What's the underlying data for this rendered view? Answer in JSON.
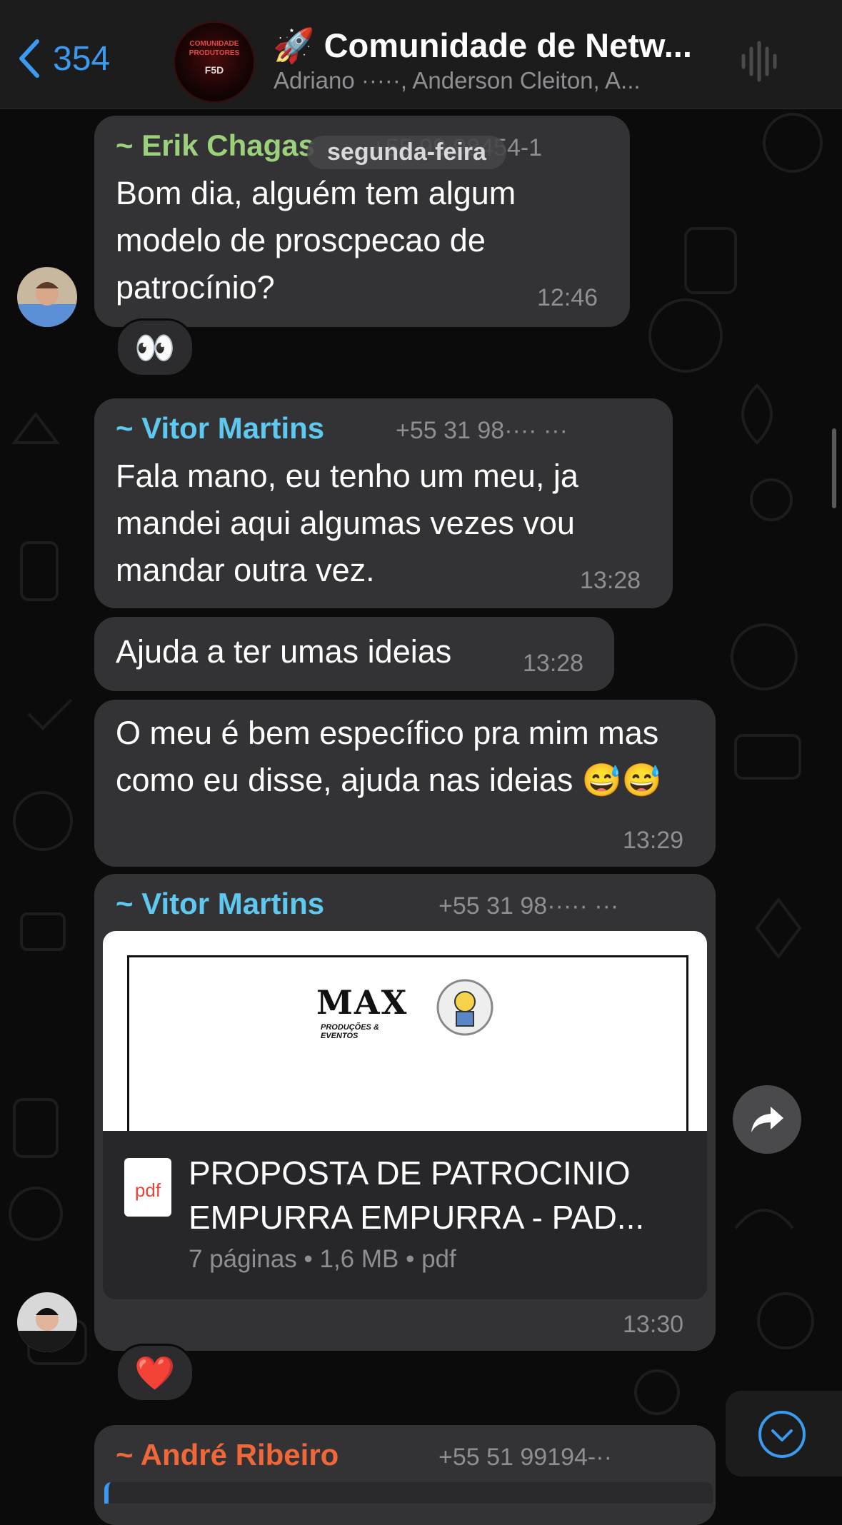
{
  "header": {
    "back_count": "354",
    "title": "🚀 Comunidade de Netw...",
    "subtitle": "Adriano ·····, Anderson Cleiton, A...",
    "avatar_text": [
      "COMUNIDADE",
      "PRODUTORES",
      "F5D"
    ]
  },
  "date_divider": "segunda-feira",
  "messages": [
    {
      "sender": "~ Erik Chagas",
      "phone": "+55 99 98454-1",
      "text": "Bom dia, alguém tem algum modelo de proscpecao de patrocínio?",
      "time": "12:46",
      "reaction": "👀"
    },
    {
      "sender": "~ Vitor Martins",
      "phone": "+55 31 98···· ···",
      "text": "Fala mano, eu tenho um meu, ja mandei aqui algumas vezes vou mandar outra vez.",
      "time": "13:28"
    },
    {
      "text": "Ajuda a ter umas ideias",
      "time": "13:28"
    },
    {
      "text": "O meu é bem específico pra mim mas como eu disse, ajuda nas ideias 😅😅",
      "time": "13:29"
    },
    {
      "sender": "~ Vitor Martins",
      "phone": "+55 31 98····· ···",
      "document": {
        "preview_logo": "MAX",
        "preview_sub": "PRODUÇÕES & EVENTOS",
        "icon_label": "pdf",
        "title": "PROPOSTA DE PATROCINIO EMPURRA EMPURRA - PAD...",
        "meta": "7 páginas • 1,6 MB • pdf"
      },
      "time": "13:30",
      "reaction": "❤️"
    },
    {
      "sender": "~ André Ribeiro",
      "phone": "+55 51 99194-··"
    }
  ],
  "colors": {
    "erik": "#9bd17b",
    "vitor": "#5ec8f0",
    "andre": "#f0673a",
    "accent": "#3a9bf0",
    "bubble": "#333335"
  }
}
